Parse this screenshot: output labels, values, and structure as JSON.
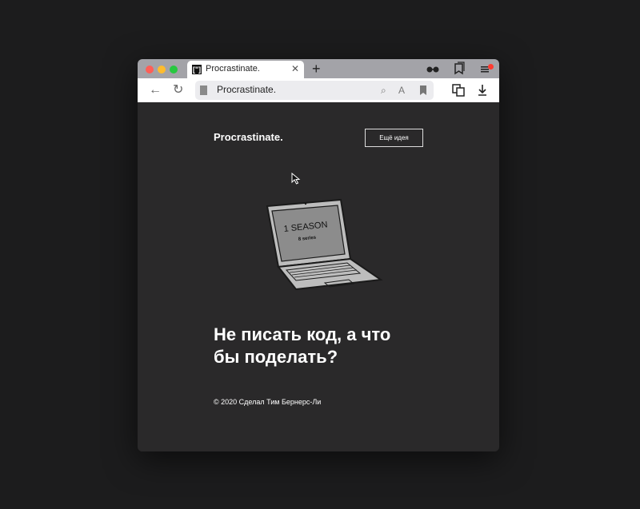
{
  "tab": {
    "title": "Procrastinate.",
    "favicon_text": "[\"]"
  },
  "address": {
    "url_text": "Procrastinate."
  },
  "page": {
    "logo": "Procrastinate.",
    "idea_button": "Ещё идея",
    "laptop_screen": {
      "line1": "1 SEASON",
      "line2": "8 series"
    },
    "headline_line1": "Не писать код, а что",
    "headline_line2": "бы поделать?",
    "footer": "© 2020 Сделал Тим Бернерс-Ли"
  },
  "colors": {
    "background": "#1c1c1d",
    "page": "#2a292a",
    "notification": "#ff3b30"
  },
  "icons": [
    "glasses-icon",
    "bookmarks-icon",
    "menu-icon",
    "back-icon",
    "reload-icon",
    "page-icon",
    "zoom-icon",
    "translate-icon",
    "bookmark-icon",
    "reader-icon",
    "download-icon"
  ]
}
